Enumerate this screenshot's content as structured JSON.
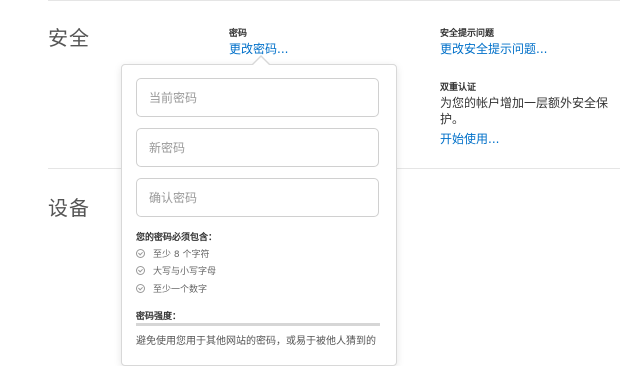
{
  "security": {
    "title": "安全",
    "password": {
      "label": "密码",
      "link": "更改密码..."
    },
    "security_questions": {
      "label": "安全提示问题",
      "link": "更改安全提示问题..."
    },
    "two_factor": {
      "label": "双重认证",
      "description": "为您的帐户增加一层额外安全保护。",
      "link": "开始使用..."
    }
  },
  "devices": {
    "title": "设备"
  },
  "popover": {
    "current_placeholder": "当前密码",
    "new_placeholder": "新密码",
    "confirm_placeholder": "确认密码",
    "requirements_title": "您的密码必须包含：",
    "requirements": [
      "至少 8 个字符",
      "大写与小写字母",
      "至少一个数字"
    ],
    "strength_label": "密码强度：",
    "hint": "避免使用您用于其他网站的密码，或易于被他人猜到的"
  }
}
